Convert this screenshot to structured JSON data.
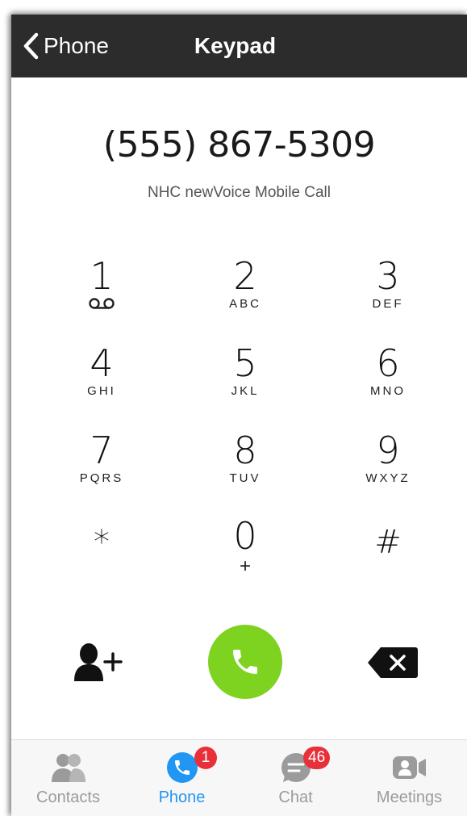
{
  "header": {
    "back_label": "Phone",
    "title": "Keypad",
    "background": "#2c2c2c"
  },
  "dialer": {
    "number": "(555) 867-5309",
    "subtitle": "NHC newVoice Mobile Call"
  },
  "keypad": [
    {
      "digit": "1",
      "letters": "",
      "icon": "voicemail-icon"
    },
    {
      "digit": "2",
      "letters": "ABC"
    },
    {
      "digit": "3",
      "letters": "DEF"
    },
    {
      "digit": "4",
      "letters": "GHI"
    },
    {
      "digit": "5",
      "letters": "JKL"
    },
    {
      "digit": "6",
      "letters": "MNO"
    },
    {
      "digit": "7",
      "letters": "PQRS"
    },
    {
      "digit": "8",
      "letters": "TUV"
    },
    {
      "digit": "9",
      "letters": "WXYZ"
    },
    {
      "digit": "*",
      "letters": ""
    },
    {
      "digit": "0",
      "letters": "+"
    },
    {
      "digit": "#",
      "letters": ""
    }
  ],
  "actions": {
    "add_contact_icon": "add-contact-icon",
    "call_icon": "phone-icon",
    "call_color": "#7ed321",
    "backspace_icon": "backspace-icon"
  },
  "tabs": [
    {
      "label": "Contacts",
      "icon": "contacts-icon",
      "badge": ""
    },
    {
      "label": "Phone",
      "icon": "phone-icon",
      "badge": "1",
      "active": true
    },
    {
      "label": "Chat",
      "icon": "chat-icon",
      "badge": "46"
    },
    {
      "label": "Meetings",
      "icon": "video-icon",
      "badge": ""
    }
  ],
  "colors": {
    "active_tab": "#2196f3",
    "inactive_tab": "#9b9b9b",
    "badge": "#e8303a"
  }
}
